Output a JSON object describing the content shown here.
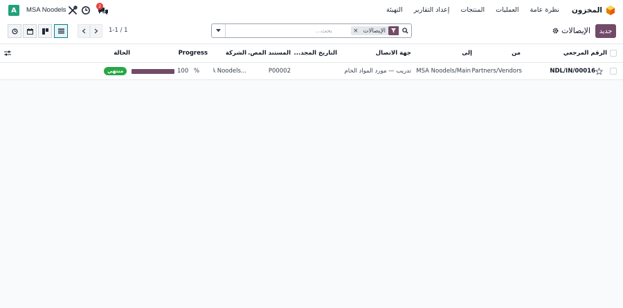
{
  "navbar": {
    "app_name": "المخزون",
    "menu": [
      "نظرة عامة",
      "العمليات",
      "المنتجات",
      "إعداد التقارير",
      "التهيئة"
    ],
    "company": "MSA Noodels",
    "avatar_letter": "A",
    "chat_badge": "2",
    "icons": [
      "inventory-app-icon",
      "tools-icon",
      "clock-icon",
      "chat-icon"
    ]
  },
  "control": {
    "new_label": "جديد",
    "breadcrumb": "الإيصالات",
    "search": {
      "facet_label": "الإيصالات",
      "placeholder": "بحث..."
    },
    "pager": "1-1 / 1"
  },
  "table": {
    "columns": [
      "الرقم المرجعي",
      "من",
      "إلى",
      "جهة الاتصال",
      "التاريخ المجد...",
      "المستند المص...",
      "الشركة",
      "Progress",
      "الحالة"
    ],
    "rows": [
      {
        "reference": "NDL/IN/00016",
        "from": "Partners/Vendors",
        "to": "MSA Noodels/Main",
        "contact": "تدريب — مورد المواد الخام",
        "scheduled": "",
        "source": "P00002",
        "company": "A Noodels...",
        "progress_value": "100",
        "progress_unit": "%",
        "status": "منتهي"
      }
    ]
  },
  "colors": {
    "brand": "#714b67",
    "avatar": "#21a179",
    "status_done": "#28a745",
    "active_view": "#017e84"
  }
}
